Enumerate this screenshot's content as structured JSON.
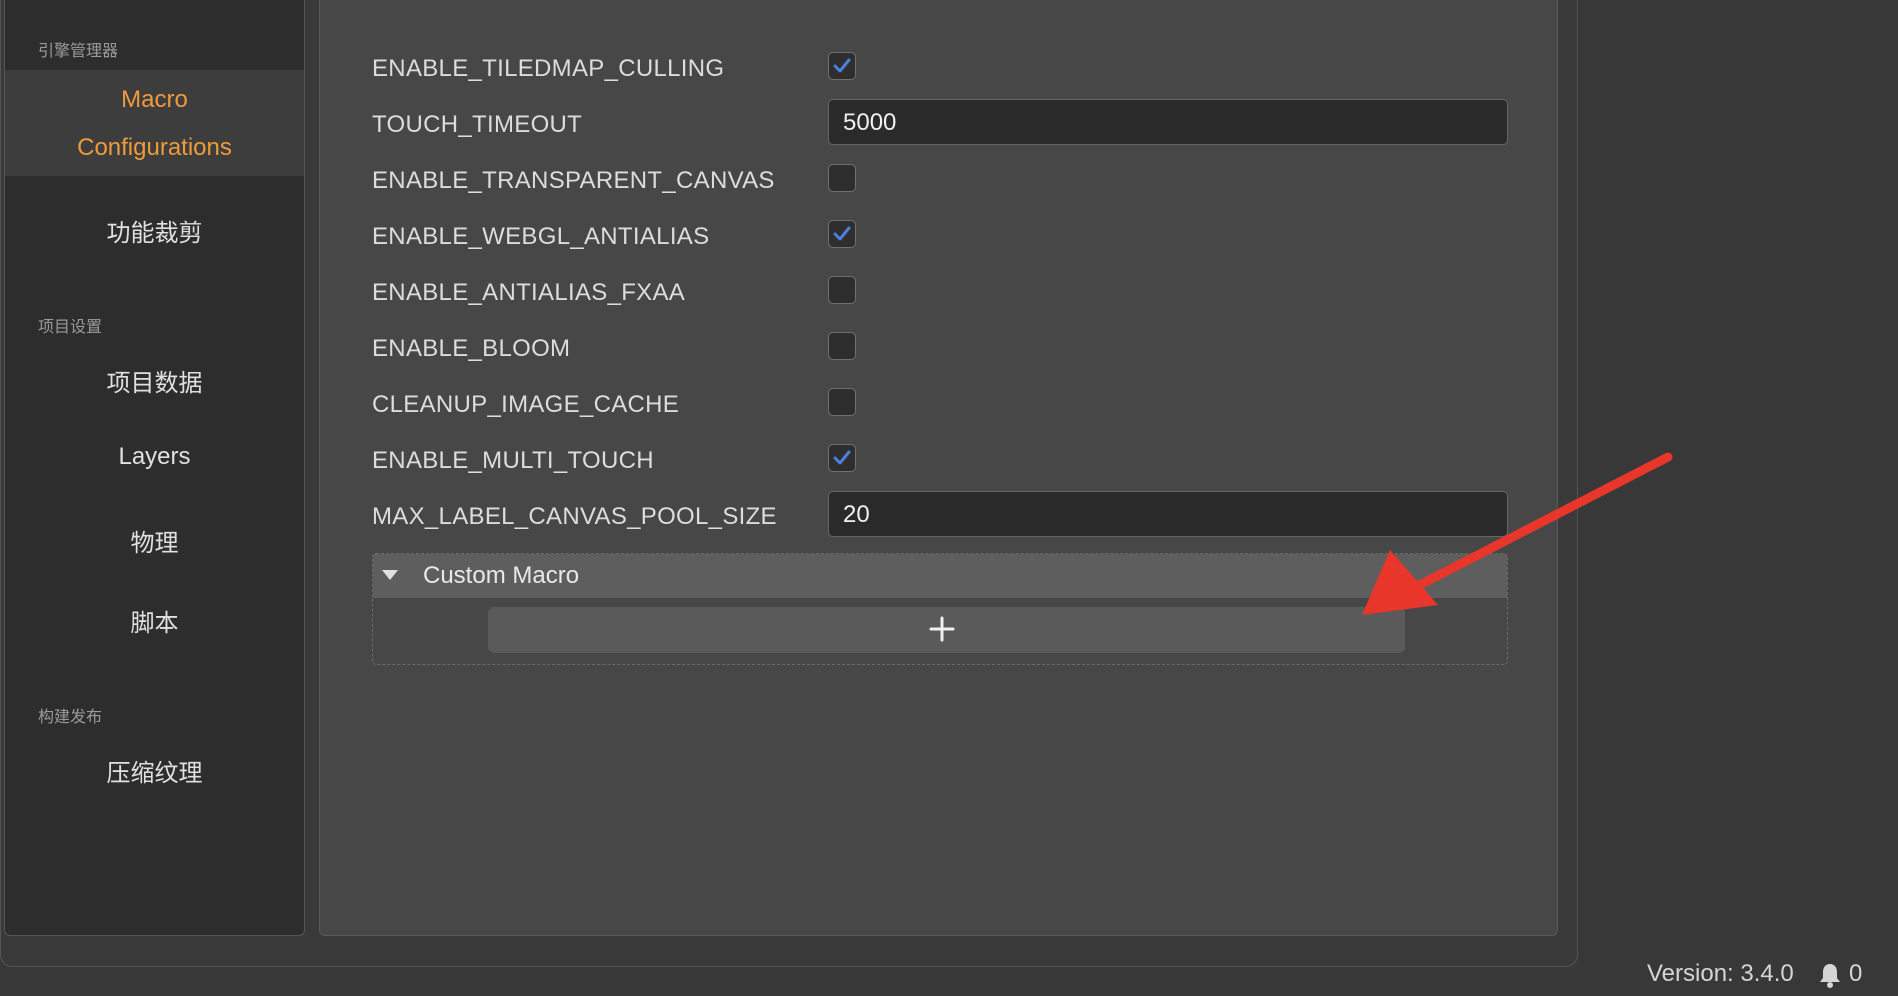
{
  "sidebar": {
    "groups": [
      {
        "title": "引擎管理器"
      },
      {
        "title": "项目设置"
      },
      {
        "title": "构建发布"
      }
    ],
    "items": {
      "macro_line1": "Macro",
      "macro_line2": "Configurations",
      "feature_crop": "功能裁剪",
      "project_data": "项目数据",
      "layers": "Layers",
      "physics": "物理",
      "scripts": "脚本",
      "texture_compress": "压缩纹理"
    }
  },
  "macros": [
    {
      "name": "ENABLE_TILEDMAP_CULLING",
      "type": "checkbox",
      "checked": true
    },
    {
      "name": "TOUCH_TIMEOUT",
      "type": "text",
      "value": "5000"
    },
    {
      "name": "ENABLE_TRANSPARENT_CANVAS",
      "type": "checkbox",
      "checked": false
    },
    {
      "name": "ENABLE_WEBGL_ANTIALIAS",
      "type": "checkbox",
      "checked": true
    },
    {
      "name": "ENABLE_ANTIALIAS_FXAA",
      "type": "checkbox",
      "checked": false
    },
    {
      "name": "ENABLE_BLOOM",
      "type": "checkbox",
      "checked": false
    },
    {
      "name": "CLEANUP_IMAGE_CACHE",
      "type": "checkbox",
      "checked": false
    },
    {
      "name": "ENABLE_MULTI_TOUCH",
      "type": "checkbox",
      "checked": true
    },
    {
      "name": "MAX_LABEL_CANVAS_POOL_SIZE",
      "type": "text",
      "value": "20"
    }
  ],
  "custom_macro": {
    "title": "Custom Macro",
    "add_label": "+"
  },
  "status_bar": {
    "version": "Version: 3.4.0",
    "notification_count": "0"
  },
  "colors": {
    "accent": "#ee9a3d",
    "checkmark": "#4a7fe0",
    "arrow": "#e8362b"
  }
}
